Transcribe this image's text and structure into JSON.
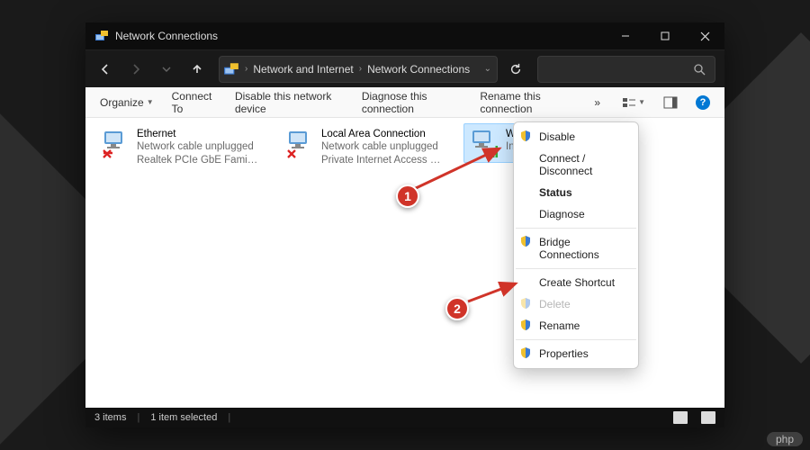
{
  "titlebar": {
    "title": "Network Connections"
  },
  "address": {
    "seg1": "Network and Internet",
    "seg2": "Network Connections"
  },
  "cmdbar": {
    "organize": "Organize",
    "connect": "Connect To",
    "disable": "Disable this network device",
    "diagnose": "Diagnose this connection",
    "rename": "Rename this connection",
    "overflow": "»"
  },
  "connections": {
    "ethernet": {
      "name": "Ethernet",
      "status": "Network cable unplugged",
      "device": "Realtek PCIe GbE Family Controller"
    },
    "lan": {
      "name": "Local Area Connection",
      "status": "Network cable unplugged",
      "device": "Private Internet Access Network A..."
    },
    "wifi": {
      "name": "Wi-Fi",
      "status": "",
      "device": "Intel(R"
    }
  },
  "ctx": {
    "disable": "Disable",
    "connect": "Connect / Disconnect",
    "status": "Status",
    "diagnose": "Diagnose",
    "bridge": "Bridge Connections",
    "shortcut": "Create Shortcut",
    "delete": "Delete",
    "rename": "Rename",
    "properties": "Properties"
  },
  "statusbar": {
    "items": "3 items",
    "selected": "1 item selected"
  },
  "markers": {
    "m1": "1",
    "m2": "2"
  },
  "watermark": "php"
}
